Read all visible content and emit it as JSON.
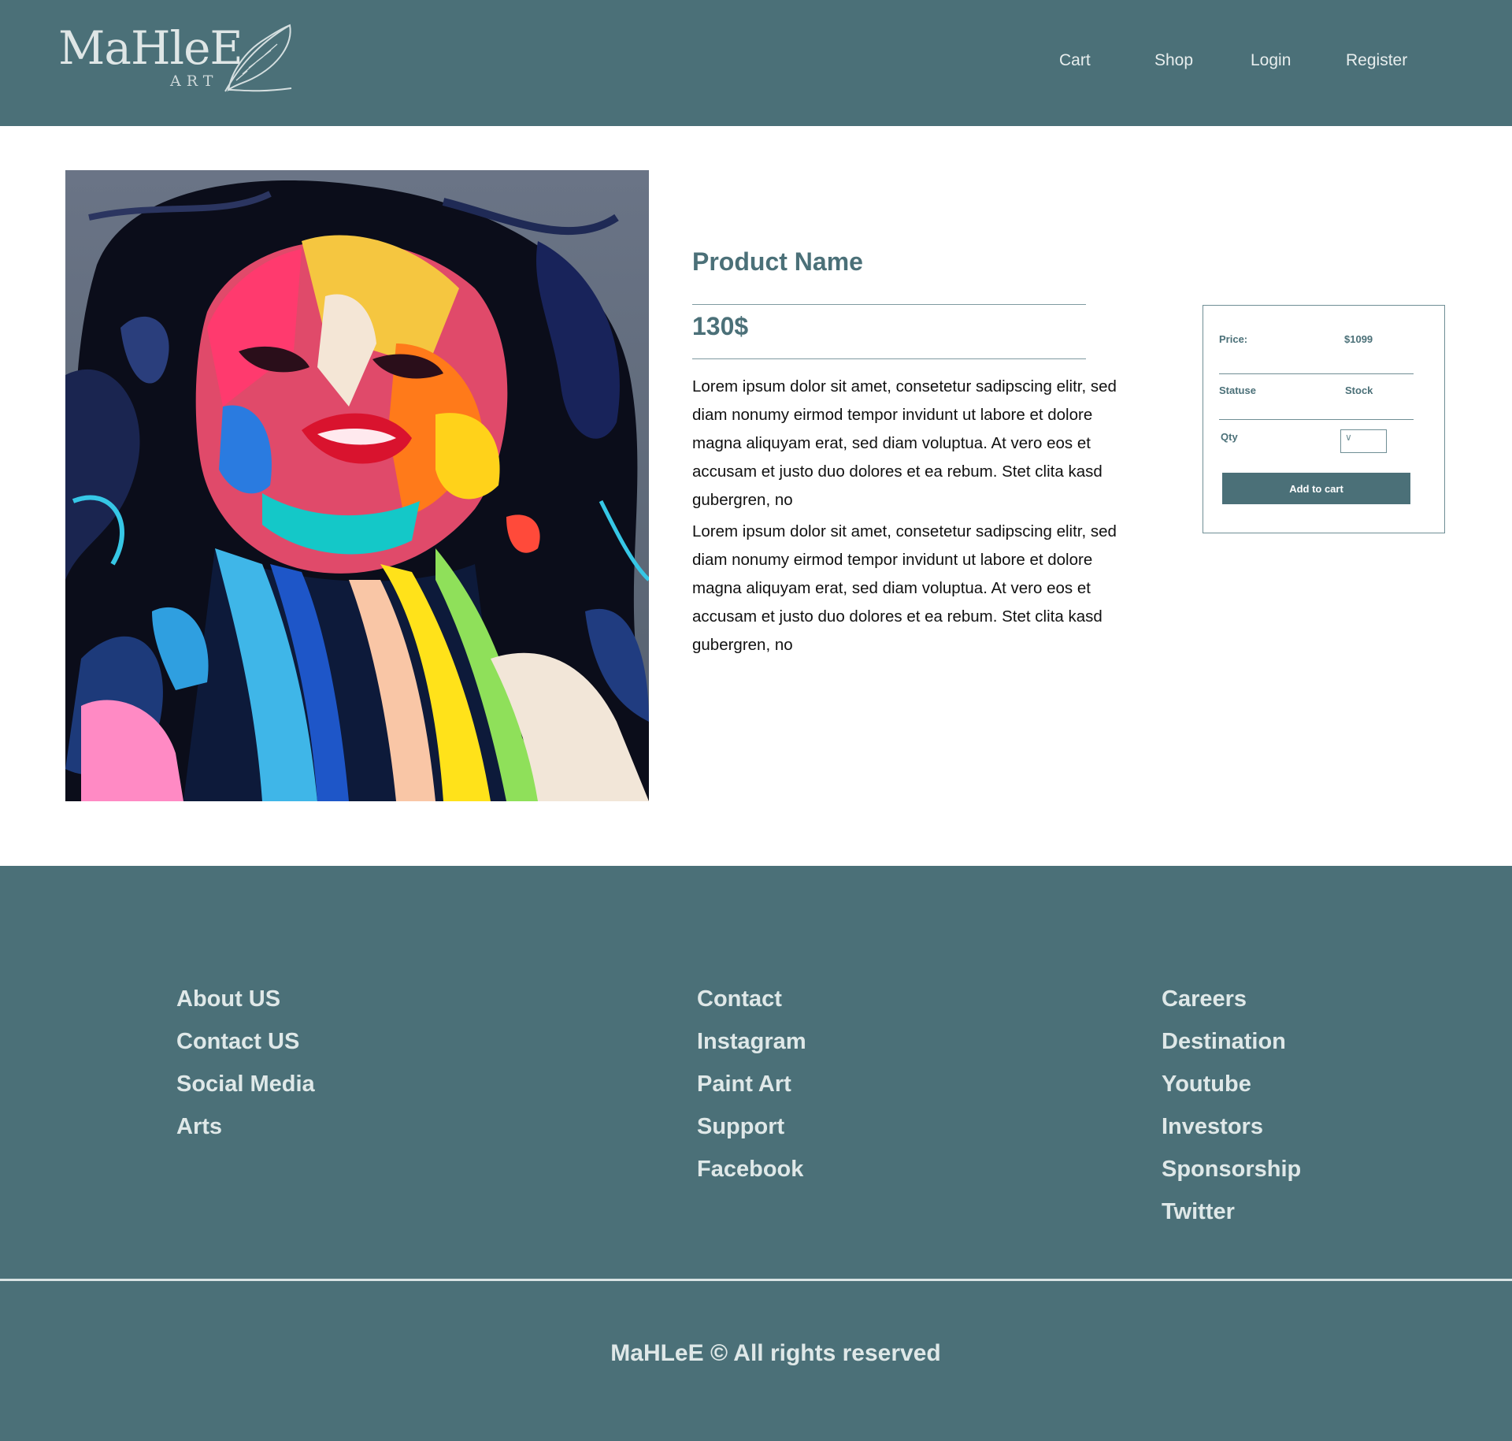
{
  "brand": {
    "name": "MaHleE",
    "sub": "ART"
  },
  "nav": {
    "items": [
      "Cart",
      "Shop",
      "Login",
      "Register"
    ]
  },
  "product": {
    "name": "Product Name",
    "price": "130$",
    "description": [
      "Lorem ipsum dolor sit amet, consetetur sadipscing elitr, sed diam nonumy eirmod tempor invidunt ut labore et dolore magna aliquyam erat, sed diam voluptua. At vero eos et accusam et justo duo dolores et ea rebum. Stet clita kasd gubergren, no",
      "Lorem ipsum dolor sit amet, consetetur sadipscing elitr, sed diam nonumy eirmod tempor invidunt ut labore et dolore magna aliquyam erat, sed diam voluptua. At vero eos et accusam et justo duo dolores et ea rebum. Stet clita kasd gubergren, no"
    ],
    "image_icon": "portrait-painting-image"
  },
  "buy_box": {
    "price_label": "Price:",
    "price_value": "$1099",
    "status_label": "Statuse",
    "status_value": "Stock",
    "qty_label": "Qty",
    "add_label": "Add to cart"
  },
  "footer": {
    "columns": [
      [
        "About US",
        "Contact US",
        "Social Media",
        "Arts"
      ],
      [
        "Contact",
        "Instagram",
        "Paint Art",
        "Support",
        "Facebook"
      ],
      [
        "Careers",
        "Destination",
        "Youtube",
        "Investors",
        "Sponsorship",
        "Twitter"
      ]
    ],
    "copyright": "MaHLeE © All rights reserved"
  },
  "colors": {
    "brand": "#4b7078",
    "footer_text": "#dfe8e8",
    "background": "#ffffff"
  }
}
